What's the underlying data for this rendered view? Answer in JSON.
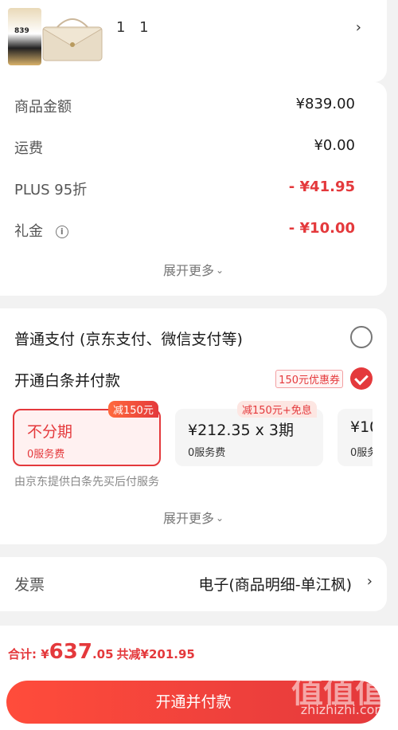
{
  "product": {
    "badge_text": "839",
    "quantity_text": "1 1",
    "chevron": "›"
  },
  "summary": {
    "rows": [
      {
        "label": "商品金额",
        "value": "¥839.00"
      },
      {
        "label": "运费",
        "value": "¥0.00"
      },
      {
        "label": "PLUS 95折",
        "value": "- ¥41.95"
      },
      {
        "label": "礼金",
        "value": "- ¥10.00"
      }
    ],
    "more_label": "展开更多",
    "info_icon": "i"
  },
  "payment": {
    "normal_label": "普通支付 (京东支付、微信支付等)",
    "baitiao_label": "开通白条并付款",
    "coupon_label": "150元优惠券",
    "plans": [
      {
        "tag": "减150元",
        "main": "不分期",
        "sub": "0服务费"
      },
      {
        "tag": "减150元+免息",
        "main": "¥212.35 x 3期",
        "sub": "0服务费"
      },
      {
        "tag": "",
        "main": "¥10",
        "sub": "0服务"
      }
    ],
    "note": "由京东提供白条先买后付服务",
    "more_label": "展开更多"
  },
  "invoice": {
    "label": "发票",
    "value": "电子(商品明细-单江枫)",
    "chevron": "›"
  },
  "bottom": {
    "total_prefix": "合计: ¥",
    "total_int": "637",
    "total_dec": ".05",
    "savings": "共减¥201.95",
    "cta_label": "开通并付款",
    "watermark": "值值值",
    "watermark_url": "zhizhizhi.com"
  },
  "colors": {
    "accent": "#e4393c",
    "background": "#f2f2f2"
  }
}
